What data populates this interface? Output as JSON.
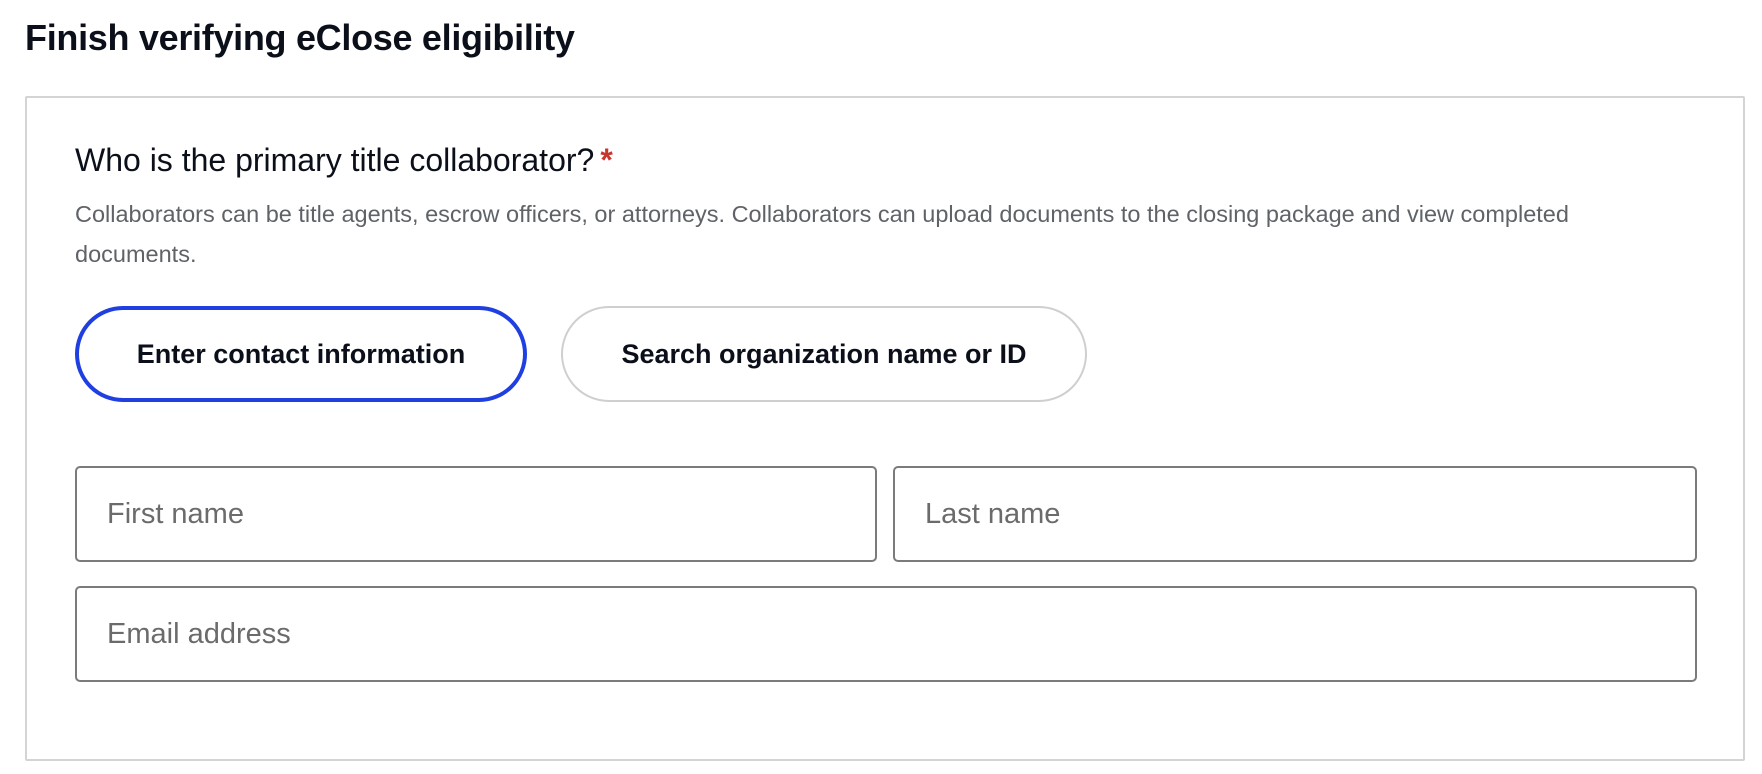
{
  "page": {
    "title": "Finish verifying eClose eligibility"
  },
  "collaborator": {
    "question": "Who is the primary title collaborator?",
    "required_marker": "*",
    "help_text": "Collaborators can be title agents, escrow officers, or attorneys. Collaborators can upload documents to the closing package and view completed documents.",
    "options": [
      {
        "label": "Enter contact information",
        "selected": true
      },
      {
        "label": "Search organization name or ID",
        "selected": false
      }
    ],
    "fields": {
      "first_name": {
        "placeholder": "First name",
        "value": ""
      },
      "last_name": {
        "placeholder": "Last name",
        "value": ""
      },
      "email": {
        "placeholder": "Email address",
        "value": ""
      }
    }
  },
  "colors": {
    "selected_border": "#1f3fe0",
    "required_star": "#c8372d",
    "help_text": "#5f6368",
    "card_border": "#d4d4d4"
  }
}
